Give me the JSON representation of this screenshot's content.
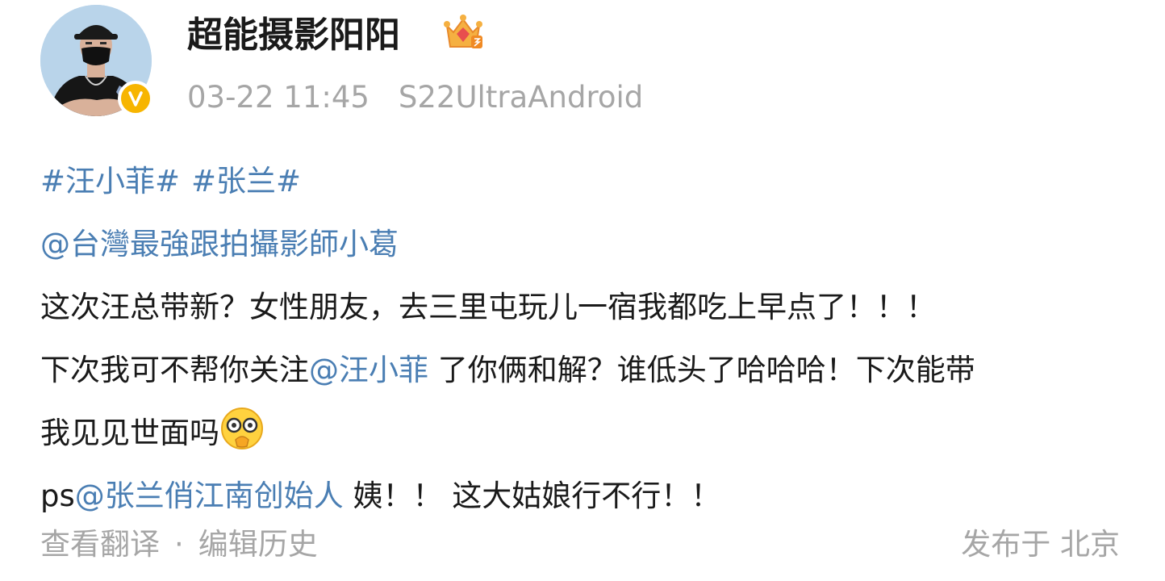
{
  "author": {
    "name": "超能摄影阳阳",
    "date": "03-22 11:45",
    "source": "S22UltraAndroid",
    "verified_color": "#f7b500",
    "badge_icon": "crown-level-icon"
  },
  "post": {
    "topic_1": "#汪小菲#",
    "topic_2": "#张兰#",
    "mention_1": "@台灣最強跟拍攝影師小葛",
    "line_3": "这次汪总带新？女性朋友，去三里屯玩儿一宿我都吃上早点了！！！",
    "line_4_pre": "下次我可不帮你关注",
    "mention_2": "@汪小菲",
    "line_4_post": " 了你俩和解？谁低头了哈哈哈！下次能带",
    "line_5": "我见见世面吗",
    "line_5_emoji": "peeking-emoji",
    "line_6_pre": "ps",
    "mention_3": "@张兰俏江南创始人",
    "line_6_post": " 姨！！ 这大姑娘行不行！！",
    "link_color": "#4a7eb3"
  },
  "footer": {
    "translate": "查看翻译",
    "separator": "·",
    "edit_history": "编辑历史",
    "location": "发布于 北京"
  }
}
